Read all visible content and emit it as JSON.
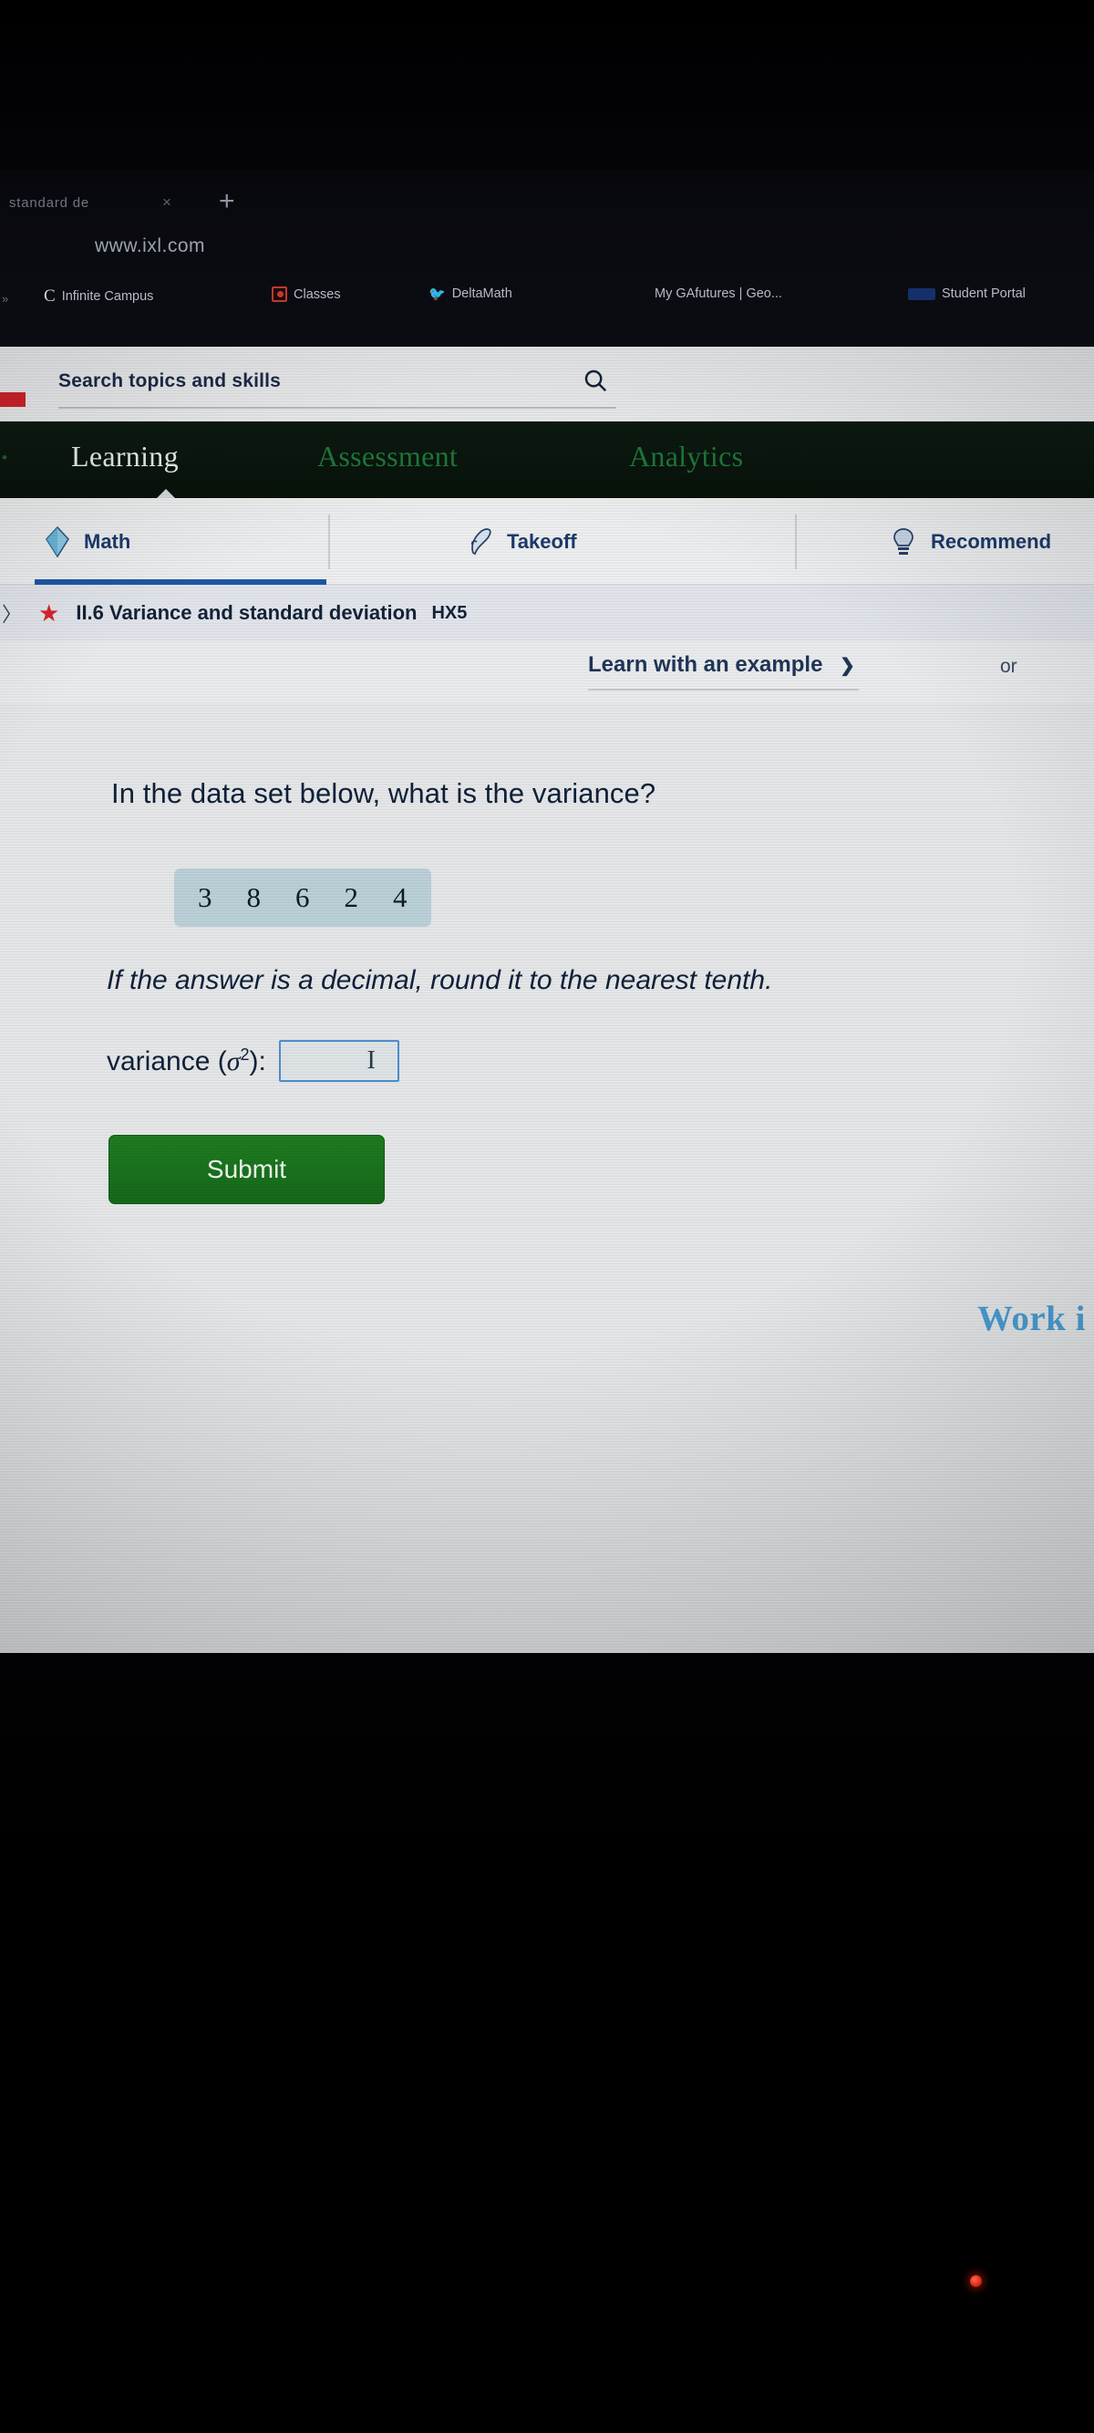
{
  "browser": {
    "tab_title": "standard de",
    "tab_close_glyph": "×",
    "new_tab_glyph": "+",
    "url": "www.ixl.com",
    "bookmarks_overflow": "»",
    "bookmarks": [
      {
        "label": "Infinite Campus",
        "icon": "letter-c-favicon",
        "glyph": "C"
      },
      {
        "label": "Classes",
        "icon": "red-square-favicon",
        "glyph": ""
      },
      {
        "label": "DeltaMath",
        "icon": "bird-favicon",
        "glyph": "🐦"
      },
      {
        "label": "My GAfutures | Geo...",
        "icon": "gafutures-favicon",
        "glyph": ""
      },
      {
        "label": "Student Portal",
        "icon": "blue-block-favicon",
        "glyph": ""
      }
    ]
  },
  "search": {
    "placeholder": "Search topics and skills",
    "value": "",
    "icon": "search-icon"
  },
  "nav": {
    "items": [
      {
        "label": "Learning",
        "active": true
      },
      {
        "label": "Assessment",
        "active": false
      },
      {
        "label": "Analytics",
        "active": false
      }
    ]
  },
  "subtabs": [
    {
      "label": "Math",
      "icon": "diamond-icon",
      "active": true
    },
    {
      "label": "Takeoff",
      "icon": "rocket-hand-icon",
      "active": false
    },
    {
      "label": "Recommend",
      "icon": "lightbulb-icon",
      "active": false
    }
  ],
  "skill": {
    "back_chevron": "〉",
    "star_icon": "star-icon",
    "title": "II.6 Variance and standard deviation",
    "code": "HX5"
  },
  "example_bar": {
    "link_label": "Learn with an example",
    "caret": "⌄",
    "or_label": "or"
  },
  "question": {
    "prompt": "In the data set below, what is the variance?",
    "dataset": [
      "3",
      "8",
      "6",
      "2",
      "4"
    ],
    "hint": "If the answer is a decimal, round it to the nearest tenth.",
    "answer_label_prefix": "variance (",
    "answer_label_symbol": "σ",
    "answer_label_exponent": "2",
    "answer_label_suffix": "):",
    "answer_value": "",
    "submit_label": "Submit"
  },
  "footer": {
    "work_it_label": "Work i"
  },
  "colors": {
    "nav_green": "#071209",
    "active_tab_blue": "#1e58a8",
    "submit_green": "#15691a",
    "dataset_blue": "#bdd2da",
    "star_red": "#d8262c",
    "work_it_blue": "#4a9fd4"
  }
}
